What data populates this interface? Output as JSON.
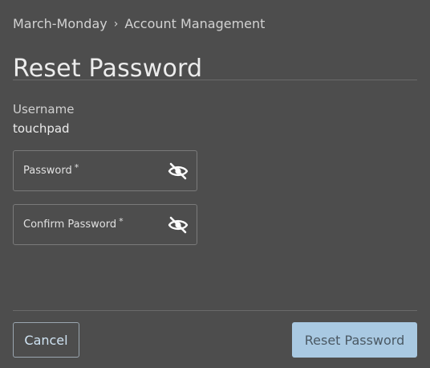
{
  "breadcrumb": {
    "items": [
      "March-Monday",
      "Account Management"
    ],
    "separator": "›"
  },
  "page": {
    "title": "Reset Password"
  },
  "user": {
    "label": "Username",
    "value": "touchpad"
  },
  "fields": {
    "password": {
      "label": "Password",
      "required_marker": "*",
      "icon": "eye-off-icon"
    },
    "confirm": {
      "label": "Confirm Password",
      "required_marker": "*",
      "icon": "eye-off-icon"
    }
  },
  "actions": {
    "cancel_label": "Cancel",
    "reset_label": "Reset Password"
  },
  "colors": {
    "background": "#4d4d4d",
    "primary_button": "#a9c9e2",
    "secondary_button_text": "#cfe3f3"
  }
}
